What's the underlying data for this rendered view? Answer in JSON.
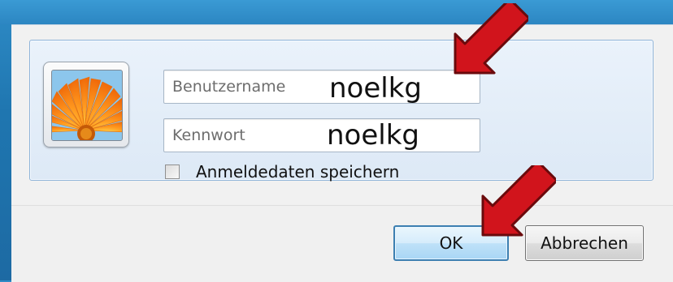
{
  "login_dialog": {
    "avatar": {
      "icon": "orange-flower-icon"
    },
    "username": {
      "placeholder": "Benutzername",
      "value": "noelkg"
    },
    "password": {
      "placeholder": "Kennwort",
      "value": "noelkg"
    },
    "remember": {
      "label": "Anmeldedaten speichern",
      "checked": false
    },
    "buttons": {
      "ok_label": "OK",
      "cancel_label": "Abbrechen"
    }
  },
  "annotations": {
    "arrows": [
      {
        "icon": "red-arrow-icon",
        "points_to": "username-field",
        "color": "#d1141c"
      },
      {
        "icon": "red-arrow-icon",
        "points_to": "ok-button",
        "color": "#d1141c"
      }
    ]
  },
  "colors": {
    "desktop": "#1f76b0",
    "panel": "#dde9f6",
    "panel_border": "#8fb4d9",
    "ok_border": "#3c7fb1",
    "arrow": "#d1141c"
  }
}
